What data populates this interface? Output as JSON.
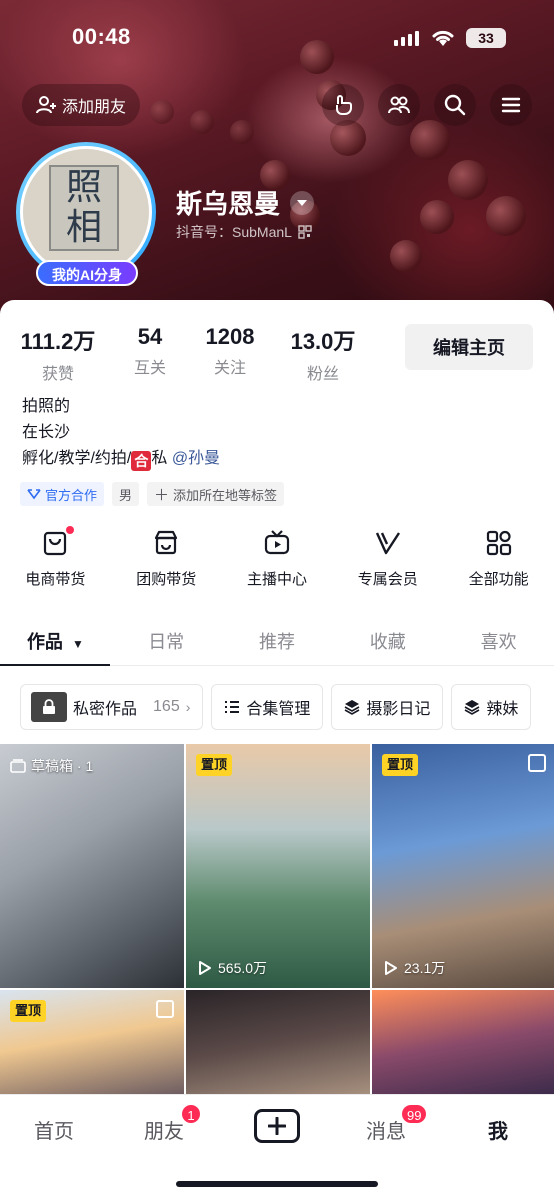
{
  "status_bar": {
    "time": "00:48",
    "battery": "33"
  },
  "header": {
    "add_friend_label": "添加朋友",
    "name": "斯乌恩曼",
    "douyin_id": "抖音号：SubManL",
    "ai_badge": "我的AI分身",
    "avatar_sign": [
      "照",
      "相"
    ]
  },
  "stats": [
    {
      "value": "111.2万",
      "label": "获赞"
    },
    {
      "value": "54",
      "label": "互关"
    },
    {
      "value": "1208",
      "label": "关注"
    },
    {
      "value": "13.0万",
      "label": "粉丝"
    }
  ],
  "edit_button": "编辑主页",
  "bio": {
    "line1": "拍照的",
    "line2": "在长沙",
    "line3_prefix": "孵化/教学/约拍/",
    "line3_icon": "合",
    "line3_suffix": "私",
    "mention": "@孙曼"
  },
  "tags": [
    "官方合作",
    "男",
    "添加所在地等标签"
  ],
  "features": [
    {
      "label": "电商带货",
      "icon": "bag-icon"
    },
    {
      "label": "团购带货",
      "icon": "shop-icon"
    },
    {
      "label": "主播中心",
      "icon": "tv-icon"
    },
    {
      "label": "专属会员",
      "icon": "v-icon"
    },
    {
      "label": "全部功能",
      "icon": "grid-icon"
    }
  ],
  "tabs": [
    "作品",
    "日常",
    "推荐",
    "收藏",
    "喜欢"
  ],
  "pills": {
    "private_label": "私密作品",
    "private_count": "165",
    "collection": "合集管理",
    "diary": "摄影日记",
    "extra": "辣妹"
  },
  "grid": {
    "draft_label": "草稿箱 · 1",
    "pin_label": "置顶",
    "plays": [
      "565.0万",
      "23.1万"
    ]
  },
  "bottom_nav": {
    "home": "首页",
    "friends": "朋友",
    "friends_badge": "1",
    "messages": "消息",
    "messages_badge": "99",
    "me": "我"
  }
}
